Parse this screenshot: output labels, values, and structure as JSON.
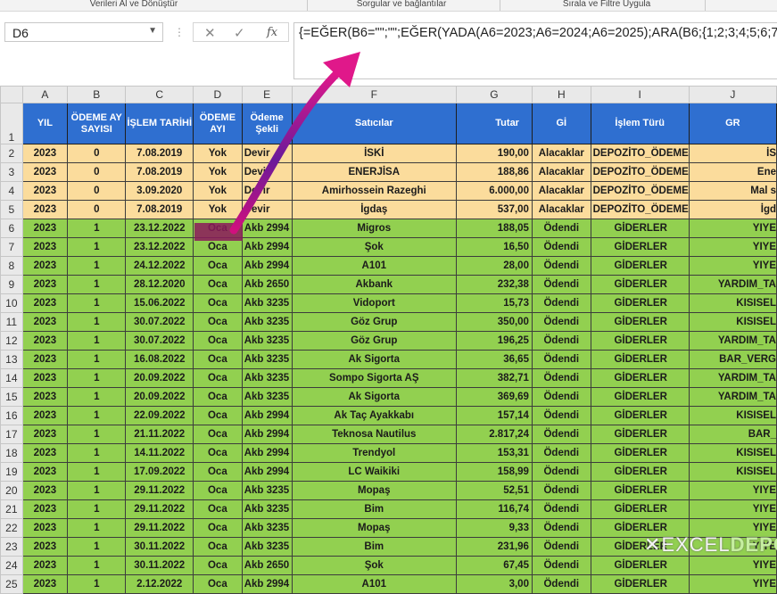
{
  "ribbon": {
    "groups": [
      "Verileri Al ve Dönüştür",
      "Sorgular ve bağlantılar",
      "Sırala ve Filtre Uygula"
    ]
  },
  "formula_bar": {
    "name_box": "D6",
    "fx": "fx",
    "formula": "{=EĞER(B6=\"\";\"\";EĞER(YADA(A6=2023;A6=2024;A6=2025);ARA(B6;{1;2;3;4;5;6;7"
  },
  "columns": [
    "A",
    "B",
    "C",
    "D",
    "E",
    "F",
    "G",
    "H",
    "I",
    "J"
  ],
  "headers": [
    "YIL",
    "ÖDEME AY SAYISI",
    "İŞLEM TARİHİ",
    "ÖDEME AYI",
    "Ödeme Şekli",
    "Satıcılar",
    "Tutar",
    "Gİ",
    "İşlem Türü",
    "GR"
  ],
  "rows": [
    {
      "n": "2",
      "style": "yel",
      "cells": [
        "2023",
        "0",
        "7.08.2019",
        "Yok",
        "Devir",
        "İSKİ",
        "190,00",
        "Alacaklar",
        "DEPOZİTO_ÖDEME",
        "İS"
      ]
    },
    {
      "n": "3",
      "style": "yel",
      "cells": [
        "2023",
        "0",
        "7.08.2019",
        "Yok",
        "Devir",
        "ENERJİSA",
        "188,86",
        "Alacaklar",
        "DEPOZİTO_ÖDEME",
        "Ene"
      ]
    },
    {
      "n": "4",
      "style": "yel",
      "cells": [
        "2023",
        "0",
        "3.09.2020",
        "Yok",
        "Devir",
        "Amirhossein Razeghi",
        "6.000,00",
        "Alacaklar",
        "DEPOZİTO_ÖDEME",
        "Mal s"
      ]
    },
    {
      "n": "5",
      "style": "yel",
      "cells": [
        "2023",
        "0",
        "7.08.2019",
        "Yok",
        "Devir",
        "İgdaş",
        "537,00",
        "Alacaklar",
        "DEPOZİTO_ÖDEME",
        "İgd"
      ]
    },
    {
      "n": "6",
      "style": "grn",
      "cells": [
        "2023",
        "1",
        "23.12.2022",
        "Oca",
        "Akb 2994",
        "Migros",
        "188,05",
        "Ödendi",
        "GİDERLER",
        "YIYE"
      ]
    },
    {
      "n": "7",
      "style": "grn",
      "cells": [
        "2023",
        "1",
        "23.12.2022",
        "Oca",
        "Akb 2994",
        "Şok",
        "16,50",
        "Ödendi",
        "GİDERLER",
        "YIYE"
      ]
    },
    {
      "n": "8",
      "style": "grn",
      "cells": [
        "2023",
        "1",
        "24.12.2022",
        "Oca",
        "Akb 2994",
        "A101",
        "28,00",
        "Ödendi",
        "GİDERLER",
        "YIYE"
      ]
    },
    {
      "n": "9",
      "style": "grn",
      "cells": [
        "2023",
        "1",
        "28.12.2020",
        "Oca",
        "Akb 2650",
        "Akbank",
        "232,38",
        "Ödendi",
        "GİDERLER",
        "YARDIM_TA"
      ]
    },
    {
      "n": "10",
      "style": "grn",
      "cells": [
        "2023",
        "1",
        "15.06.2022",
        "Oca",
        "Akb 3235",
        "Vidoport",
        "15,73",
        "Ödendi",
        "GİDERLER",
        "KISISEL"
      ]
    },
    {
      "n": "11",
      "style": "grn",
      "cells": [
        "2023",
        "1",
        "30.07.2022",
        "Oca",
        "Akb 3235",
        "Göz Grup",
        "350,00",
        "Ödendi",
        "GİDERLER",
        "KISISEL"
      ]
    },
    {
      "n": "12",
      "style": "grn",
      "cells": [
        "2023",
        "1",
        "30.07.2022",
        "Oca",
        "Akb 3235",
        "Göz Grup",
        "196,25",
        "Ödendi",
        "GİDERLER",
        "YARDIM_TA"
      ]
    },
    {
      "n": "13",
      "style": "grn",
      "cells": [
        "2023",
        "1",
        "16.08.2022",
        "Oca",
        "Akb 3235",
        "Ak Sigorta",
        "36,65",
        "Ödendi",
        "GİDERLER",
        "BAR_VERG"
      ]
    },
    {
      "n": "14",
      "style": "grn",
      "cells": [
        "2023",
        "1",
        "20.09.2022",
        "Oca",
        "Akb 3235",
        "Sompo Sigorta AŞ",
        "382,71",
        "Ödendi",
        "GİDERLER",
        "YARDIM_TA"
      ]
    },
    {
      "n": "15",
      "style": "grn",
      "cells": [
        "2023",
        "1",
        "20.09.2022",
        "Oca",
        "Akb 3235",
        "Ak Sigorta",
        "369,69",
        "Ödendi",
        "GİDERLER",
        "YARDIM_TA"
      ]
    },
    {
      "n": "16",
      "style": "grn",
      "cells": [
        "2023",
        "1",
        "22.09.2022",
        "Oca",
        "Akb 2994",
        "Ak Taç Ayakkabı",
        "157,14",
        "Ödendi",
        "GİDERLER",
        "KISISEL"
      ]
    },
    {
      "n": "17",
      "style": "grn",
      "cells": [
        "2023",
        "1",
        "21.11.2022",
        "Oca",
        "Akb 2994",
        "Teknosa Nautilus",
        "2.817,24",
        "Ödendi",
        "GİDERLER",
        "BAR_"
      ]
    },
    {
      "n": "18",
      "style": "grn",
      "cells": [
        "2023",
        "1",
        "14.11.2022",
        "Oca",
        "Akb 2994",
        "Trendyol",
        "153,31",
        "Ödendi",
        "GİDERLER",
        "KISISEL"
      ]
    },
    {
      "n": "19",
      "style": "grn",
      "cells": [
        "2023",
        "1",
        "17.09.2022",
        "Oca",
        "Akb 2994",
        "LC Waikiki",
        "158,99",
        "Ödendi",
        "GİDERLER",
        "KISISEL"
      ]
    },
    {
      "n": "20",
      "style": "grn",
      "cells": [
        "2023",
        "1",
        "29.11.2022",
        "Oca",
        "Akb 3235",
        "Mopaş",
        "52,51",
        "Ödendi",
        "GİDERLER",
        "YIYE"
      ]
    },
    {
      "n": "21",
      "style": "grn",
      "cells": [
        "2023",
        "1",
        "29.11.2022",
        "Oca",
        "Akb 3235",
        "Bim",
        "116,74",
        "Ödendi",
        "GİDERLER",
        "YIYE"
      ]
    },
    {
      "n": "22",
      "style": "grn",
      "cells": [
        "2023",
        "1",
        "29.11.2022",
        "Oca",
        "Akb 3235",
        "Mopaş",
        "9,33",
        "Ödendi",
        "GİDERLER",
        "YIYE"
      ]
    },
    {
      "n": "23",
      "style": "grn",
      "cells": [
        "2023",
        "1",
        "30.11.2022",
        "Oca",
        "Akb 3235",
        "Bim",
        "231,96",
        "Ödendi",
        "GİDERLER",
        "YIYE"
      ]
    },
    {
      "n": "24",
      "style": "grn",
      "cells": [
        "2023",
        "1",
        "30.11.2022",
        "Oca",
        "Akb 2650",
        "Şok",
        "67,45",
        "Ödendi",
        "GİDERLER",
        "YIYE"
      ]
    },
    {
      "n": "25",
      "style": "grn",
      "cells": [
        "2023",
        "1",
        "2.12.2022",
        "Oca",
        "Akb 2994",
        "A101",
        "3,00",
        "Ödendi",
        "GİDERLER",
        "YIYE"
      ]
    }
  ],
  "watermark": {
    "a": "EXCEL",
    "b": "DEPO"
  },
  "colors": {
    "header_blue": "#2f6fd0",
    "row_yellow": "#fbdc9c",
    "row_green": "#92d050",
    "arrow": "#c2128a",
    "selected_cell": "#8b1a5a"
  }
}
